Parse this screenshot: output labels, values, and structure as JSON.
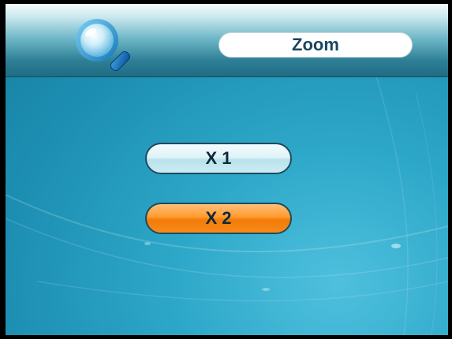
{
  "header": {
    "title": "Zoom",
    "icon": "search-icon"
  },
  "options": [
    {
      "label": "X 1",
      "selected": false
    },
    {
      "label": "X 2",
      "selected": true
    }
  ],
  "colors": {
    "header_light": "#f3fbfc",
    "header_dark": "#1f6c83",
    "background": "#2da7c8",
    "button_normal": "#dff3f8",
    "button_selected": "#ff9a2e",
    "text_dark": "#1a4660"
  }
}
